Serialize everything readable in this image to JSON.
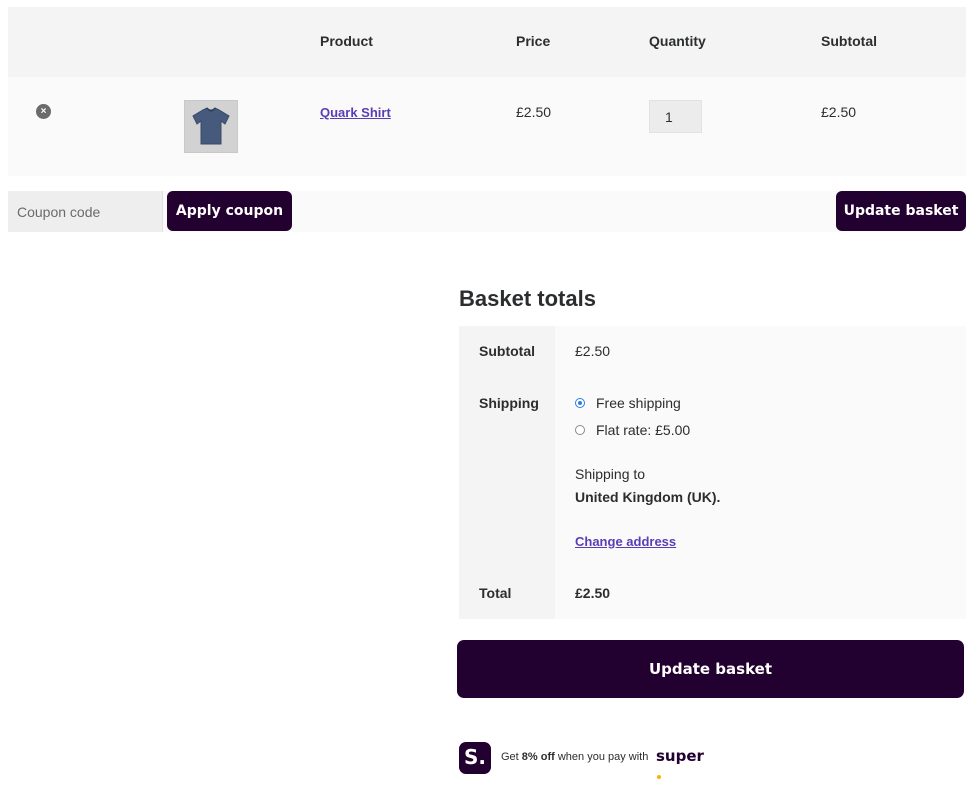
{
  "cart": {
    "headers": {
      "product": "Product",
      "price": "Price",
      "quantity": "Quantity",
      "subtotal": "Subtotal"
    },
    "items": [
      {
        "name": "Quark Shirt",
        "price": "£2.50",
        "quantity": "1",
        "subtotal": "£2.50",
        "remove_icon": "close-circle-icon",
        "thumbnail": "t-shirt"
      }
    ]
  },
  "actions": {
    "coupon_placeholder": "Coupon code",
    "apply_coupon_label": "Apply coupon",
    "update_basket_label": "Update basket"
  },
  "totals": {
    "title": "Basket totals",
    "subtotal_label": "Subtotal",
    "subtotal_value": "£2.50",
    "shipping_label": "Shipping",
    "shipping_options": [
      {
        "label": "Free shipping",
        "selected": true
      },
      {
        "label": "Flat rate: £5.00",
        "selected": false
      }
    ],
    "shipping_to_text": "Shipping to",
    "shipping_destination": "United Kingdom (UK).",
    "change_address_label": "Change address",
    "total_label": "Total",
    "total_value": "£2.50",
    "update_basket_label": "Update basket"
  },
  "promo": {
    "badge_letter": "S.",
    "text_prefix": "Get ",
    "text_bold": "8% off",
    "text_suffix": " when you pay with",
    "brand": "super"
  },
  "colors": {
    "button_bg": "#22002f",
    "link": "#5a3db5",
    "radio_selected": "#2f7de1",
    "brand_dot": "#f7b500"
  }
}
